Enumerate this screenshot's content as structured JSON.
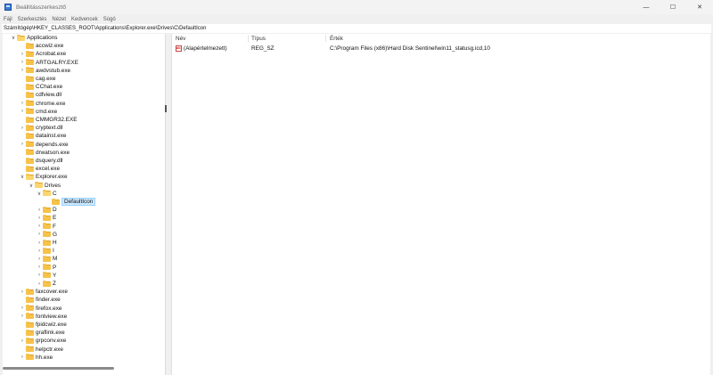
{
  "window": {
    "title": "Beállításszerkesztő",
    "minimize": "—",
    "maximize": "☐",
    "close": "✕"
  },
  "menu": [
    "Fájl",
    "Szerkesztés",
    "Nézet",
    "Kedvencek",
    "Súgó"
  ],
  "address": "Számítógép\\HKEY_CLASSES_ROOT\\Applications\\Explorer.exe\\Drives\\C\\DefaultIcon",
  "tree": [
    {
      "label": "Applications",
      "level": 0,
      "chev": "∨",
      "open": true
    },
    {
      "label": "accwiz.exe",
      "level": 1,
      "chev": ""
    },
    {
      "label": "Acrobat.exe",
      "level": 1,
      "chev": "›"
    },
    {
      "label": "ARTGALRY.EXE",
      "level": 1,
      "chev": "›"
    },
    {
      "label": "awdvstub.exe",
      "level": 1,
      "chev": "›"
    },
    {
      "label": "cag.exe",
      "level": 1,
      "chev": ""
    },
    {
      "label": "CChat.exe",
      "level": 1,
      "chev": ""
    },
    {
      "label": "cdfview.dll",
      "level": 1,
      "chev": ""
    },
    {
      "label": "chrome.exe",
      "level": 1,
      "chev": "›"
    },
    {
      "label": "cmd.exe",
      "level": 1,
      "chev": "›"
    },
    {
      "label": "CMMGR32.EXE",
      "level": 1,
      "chev": ""
    },
    {
      "label": "cryptext.dll",
      "level": 1,
      "chev": "›"
    },
    {
      "label": "datainst.exe",
      "level": 1,
      "chev": ""
    },
    {
      "label": "depends.exe",
      "level": 1,
      "chev": "›"
    },
    {
      "label": "drwatson.exe",
      "level": 1,
      "chev": ""
    },
    {
      "label": "dsquery.dll",
      "level": 1,
      "chev": ""
    },
    {
      "label": "excel.exe",
      "level": 1,
      "chev": ""
    },
    {
      "label": "Explorer.exe",
      "level": 1,
      "chev": "∨",
      "open": true
    },
    {
      "label": "Drives",
      "level": 2,
      "chev": "∨",
      "open": true
    },
    {
      "label": "C",
      "level": 3,
      "chev": "∨",
      "open": true
    },
    {
      "label": "DefaultIcon",
      "level": 4,
      "chev": "",
      "selected": true
    },
    {
      "label": "D",
      "level": 3,
      "chev": "›"
    },
    {
      "label": "E",
      "level": 3,
      "chev": "›"
    },
    {
      "label": "F",
      "level": 3,
      "chev": "›"
    },
    {
      "label": "G",
      "level": 3,
      "chev": "›"
    },
    {
      "label": "H",
      "level": 3,
      "chev": "›"
    },
    {
      "label": "I",
      "level": 3,
      "chev": "›"
    },
    {
      "label": "M",
      "level": 3,
      "chev": "›"
    },
    {
      "label": "P",
      "level": 3,
      "chev": "›"
    },
    {
      "label": "Y",
      "level": 3,
      "chev": "›"
    },
    {
      "label": "Z",
      "level": 3,
      "chev": "›"
    },
    {
      "label": "faxcover.exe",
      "level": 1,
      "chev": "›"
    },
    {
      "label": "finder.exe",
      "level": 1,
      "chev": ""
    },
    {
      "label": "firefox.exe",
      "level": 1,
      "chev": "›"
    },
    {
      "label": "fontview.exe",
      "level": 1,
      "chev": "›"
    },
    {
      "label": "fpidcwiz.exe",
      "level": 1,
      "chev": ""
    },
    {
      "label": "graflink.exe",
      "level": 1,
      "chev": ""
    },
    {
      "label": "grpconv.exe",
      "level": 1,
      "chev": "›"
    },
    {
      "label": "helpctr.exe",
      "level": 1,
      "chev": ""
    },
    {
      "label": "hh.exe",
      "level": 1,
      "chev": "›"
    }
  ],
  "columns": {
    "name": "Név",
    "type": "Típus",
    "data": "Érték"
  },
  "values": [
    {
      "name": "(Alapértelmezett)",
      "type": "REG_SZ",
      "data": "C:\\Program Files (x86)\\Hard Disk Sentinel\\win11_statusg.icd,10"
    }
  ]
}
